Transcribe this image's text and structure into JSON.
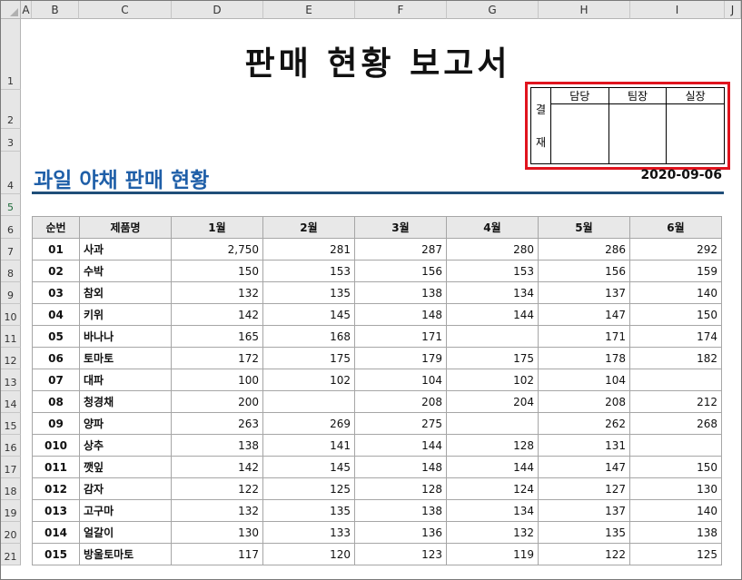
{
  "columns": [
    "A",
    "B",
    "C",
    "D",
    "E",
    "F",
    "G",
    "H",
    "I",
    "J"
  ],
  "rows": [
    "1",
    "2",
    "3",
    "4",
    "5",
    "6",
    "7",
    "8",
    "9",
    "10",
    "11",
    "12",
    "13",
    "14",
    "15",
    "16",
    "17",
    "18",
    "19",
    "20",
    "21"
  ],
  "selected": {
    "column": "",
    "row": "5"
  },
  "report_title": "판매 현황 보고서",
  "approval": {
    "side_label_top": "결",
    "side_label_bottom": "재",
    "headers": [
      "담당",
      "팀장",
      "실장"
    ],
    "highlight_color": "#e0141e"
  },
  "section_title": "과일 야채 판매 현황",
  "date": "2020-09-06",
  "colors": {
    "section_title": "#1f5fa8",
    "underline": "#1f4e79",
    "header_bg": "#e8e8e8"
  },
  "table": {
    "headers": [
      "순번",
      "제품명",
      "1월",
      "2월",
      "3월",
      "4월",
      "5월",
      "6월"
    ],
    "rows": [
      [
        "01",
        "사과",
        "2,750",
        "281",
        "287",
        "280",
        "286",
        "292"
      ],
      [
        "02",
        "수박",
        "150",
        "153",
        "156",
        "153",
        "156",
        "159"
      ],
      [
        "03",
        "참외",
        "132",
        "135",
        "138",
        "134",
        "137",
        "140"
      ],
      [
        "04",
        "키위",
        "142",
        "145",
        "148",
        "144",
        "147",
        "150"
      ],
      [
        "05",
        "바나나",
        "165",
        "168",
        "171",
        "",
        "171",
        "174"
      ],
      [
        "06",
        "토마토",
        "172",
        "175",
        "179",
        "175",
        "178",
        "182"
      ],
      [
        "07",
        "대파",
        "100",
        "102",
        "104",
        "102",
        "104",
        ""
      ],
      [
        "08",
        "청경채",
        "200",
        "",
        "208",
        "204",
        "208",
        "212"
      ],
      [
        "09",
        "양파",
        "263",
        "269",
        "275",
        "",
        "262",
        "268"
      ],
      [
        "010",
        "상추",
        "138",
        "141",
        "144",
        "128",
        "131",
        ""
      ],
      [
        "011",
        "깻잎",
        "142",
        "145",
        "148",
        "144",
        "147",
        "150"
      ],
      [
        "012",
        "감자",
        "122",
        "125",
        "128",
        "124",
        "127",
        "130"
      ],
      [
        "013",
        "고구마",
        "132",
        "135",
        "138",
        "134",
        "137",
        "140"
      ],
      [
        "014",
        "얼갈이",
        "130",
        "133",
        "136",
        "132",
        "135",
        "138"
      ],
      [
        "015",
        "방울토마토",
        "117",
        "120",
        "123",
        "119",
        "122",
        "125"
      ]
    ]
  }
}
